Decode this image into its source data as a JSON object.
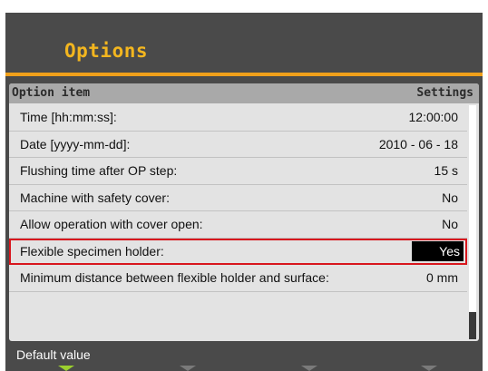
{
  "title": "Options",
  "table": {
    "header_item": "Option item",
    "header_settings": "Settings",
    "rows": [
      {
        "label": "Time [hh:mm:ss]:",
        "value": "12:00:00"
      },
      {
        "label": "Date [yyyy-mm-dd]:",
        "value": "2010 - 06 - 18"
      },
      {
        "label": "Flushing time after OP step:",
        "value": "15 s"
      },
      {
        "label": "Machine with safety cover:",
        "value": "No"
      },
      {
        "label": "Allow operation with cover open:",
        "value": "No"
      },
      {
        "label": "Flexible specimen holder:",
        "value": "Yes",
        "selected": true
      },
      {
        "label": "Minimum distance between flexible holder and surface:",
        "value": "0 mm"
      }
    ]
  },
  "footer": {
    "hint": "Default value"
  },
  "softkeys": [
    {
      "name": "softkey-1",
      "active": true
    },
    {
      "name": "softkey-2",
      "active": false
    },
    {
      "name": "softkey-3",
      "active": false
    },
    {
      "name": "softkey-4",
      "active": false
    }
  ],
  "colors": {
    "title": "#f3b61f",
    "accent_line": "#f0a01a",
    "selection": "#d8171e",
    "active_softkey": "#9bcf2e"
  }
}
